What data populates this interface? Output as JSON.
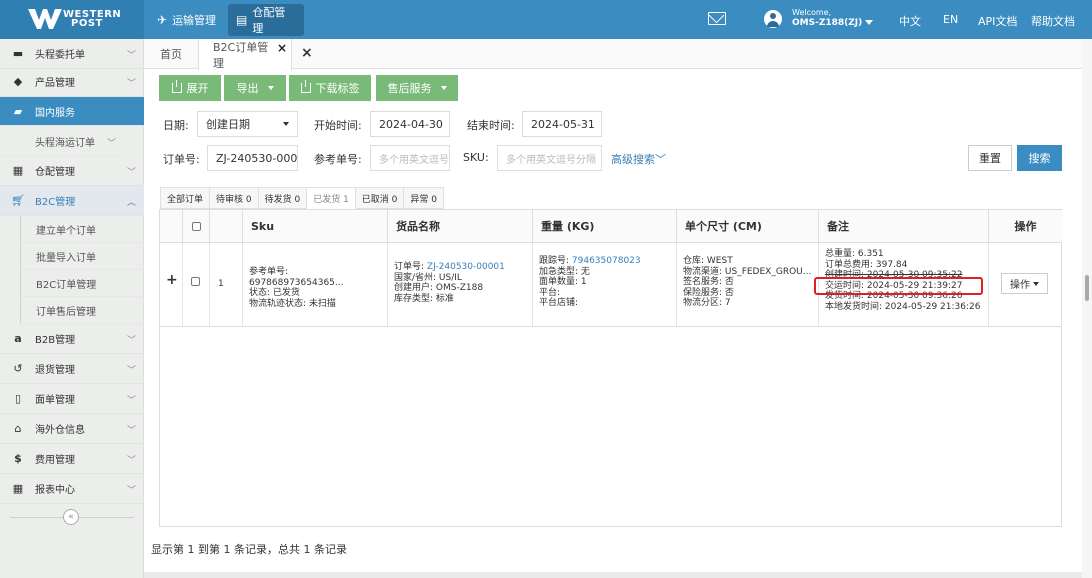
{
  "brand": {
    "line1": "WESTERN",
    "line2": "POST"
  },
  "topnav": [
    {
      "label": "运输管理",
      "icon": "plane-icon"
    },
    {
      "label": "仓配管理",
      "icon": "document-icon"
    }
  ],
  "user": {
    "welcome": "Welcome,",
    "name": "OMS-Z188(ZJ)"
  },
  "toplinks": {
    "zh": "中文",
    "en": "EN",
    "api": "API文档",
    "help": "帮助文档"
  },
  "sidebar": {
    "items": [
      {
        "label": "头程委托单",
        "icon": "briefcase-icon"
      },
      {
        "label": "产品管理",
        "icon": "tag-icon"
      },
      {
        "label": "国内服务",
        "icon": "folder-icon"
      },
      {
        "label": "头程海运订单"
      },
      {
        "label": "仓配管理",
        "icon": "grid-icon"
      },
      {
        "label": "B2C管理",
        "icon": "cart-icon"
      },
      {
        "label": "建立单个订单"
      },
      {
        "label": "批量导入订单"
      },
      {
        "label": "B2C订单管理"
      },
      {
        "label": "订单售后管理"
      },
      {
        "label": "B2B管理",
        "icon": "amazon-icon"
      },
      {
        "label": "退货管理",
        "icon": "return-icon"
      },
      {
        "label": "面单管理",
        "icon": "file-icon"
      },
      {
        "label": "海外仓信息",
        "icon": "home-icon"
      },
      {
        "label": "费用管理",
        "icon": "dollar-icon"
      },
      {
        "label": "报表中心",
        "icon": "table-icon"
      }
    ],
    "collapse": "«"
  },
  "tabs": {
    "home": "首页",
    "b2c": "B2C订单管理"
  },
  "toolbar": {
    "expand": "展开",
    "export": "导出",
    "download": "下载标签",
    "after_sales": "售后服务"
  },
  "filters": {
    "date_label": "日期:",
    "date_type": "创建日期",
    "start_label": "开始时间:",
    "start": "2024-04-30",
    "end_label": "结束时间:",
    "end": "2024-05-31",
    "order_label": "订单号:",
    "order_value": "ZJ-240530-00001",
    "ref_label": "参考单号:",
    "ref_placeholder": "多个用英文逗号分隔",
    "sku_label": "SKU:",
    "sku_placeholder": "多个用英文逗号分隔",
    "advanced": "高级搜索",
    "reset": "重置",
    "search": "搜索"
  },
  "status_tabs": [
    "全部订单",
    "待审核 0",
    "待发货 0",
    "已发货 1",
    "已取消 0",
    "异常 0"
  ],
  "columns": {
    "sku": "Sku",
    "goods": "货品名称",
    "weight": "重量 (KG)",
    "size": "单个尺寸 (CM)",
    "remark": "备注",
    "op": "操作"
  },
  "row": {
    "expand": "+",
    "index": "1",
    "sku": [
      "参考单号: 697868973654365...",
      "状态: 已发货",
      "物流轨迹状态: 未扫描"
    ],
    "goods": {
      "order_label": "订单号: ",
      "order_no": "ZJ-240530-00001",
      "country": "国家/省州: US/IL",
      "creator": "创建用户: OMS-Z188",
      "stock": "库存类型: 标准"
    },
    "weight": {
      "track_label": "跟踪号: ",
      "track_no": "794635078023",
      "extra": "加急类型: 无",
      "qty": "面单数量: 1",
      "platform": "平台:",
      "shop": "平台店铺:"
    },
    "size": {
      "wh": "仓库: WEST",
      "channel": "物流渠道: US_FEDEX_GROU...",
      "sign": "签名服务: 否",
      "insurance": "保险服务: 否",
      "zone": "物流分区: 7"
    },
    "remark": {
      "total_weight": "总重量: 6.351",
      "fee": "订单总费用: 397.84",
      "created": "创建时间: 2024-05-30 09:35:22",
      "handover": "交运时间: 2024-05-29 21:39:27",
      "shipped": "发货时间: 2024-05-30 09:36:26",
      "local_ship": "本地发货时间: 2024-05-29 21:36:26"
    },
    "op": "操作"
  },
  "footer": "显示第 1 到第 1 条记录，总共 1 条记录"
}
